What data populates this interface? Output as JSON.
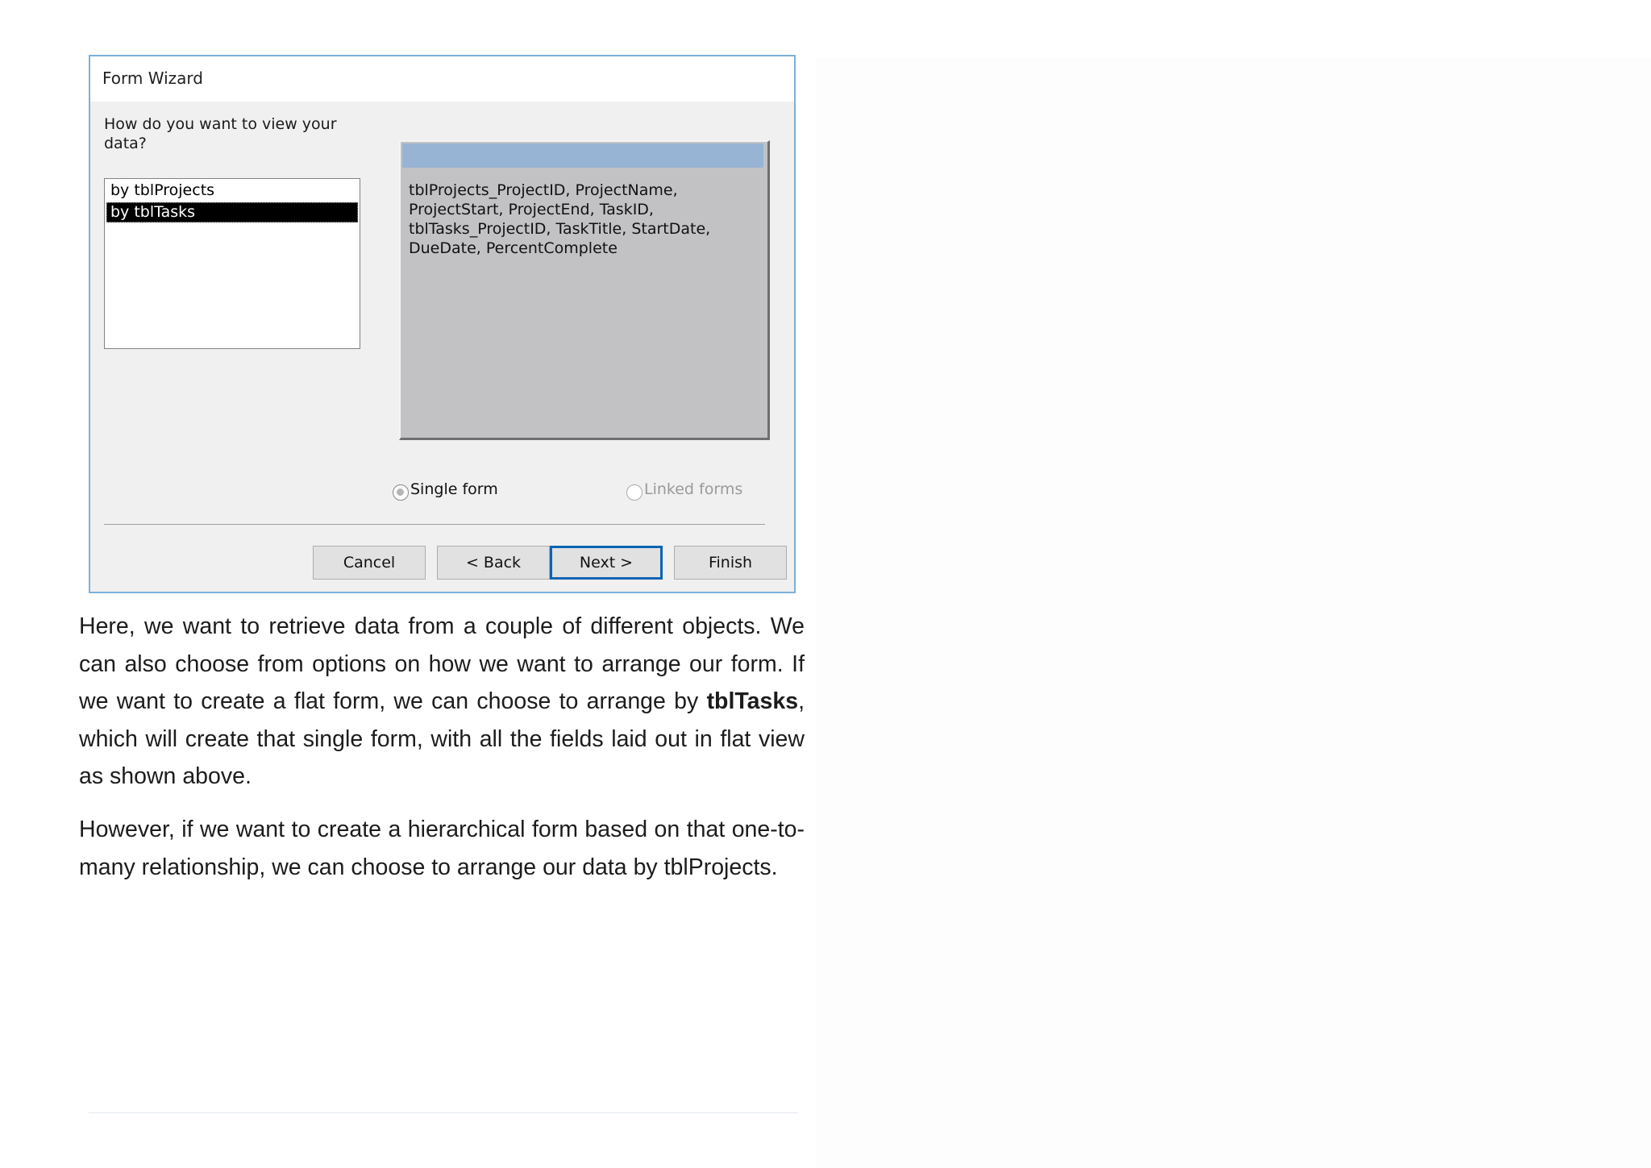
{
  "dialog": {
    "title": "Form Wizard",
    "question": "How do you want to view your data?",
    "view_options": [
      {
        "label": "by tblProjects",
        "selected": false
      },
      {
        "label": "by tblTasks",
        "selected": true
      }
    ],
    "preview_fields": "tblProjects_ProjectID, ProjectName, ProjectStart, ProjectEnd, TaskID, tblTasks_ProjectID, TaskTitle, StartDate, DueDate, PercentComplete",
    "radio_options": [
      {
        "label": "Single form",
        "checked": true,
        "enabled": true
      },
      {
        "label": "Linked forms",
        "checked": false,
        "enabled": false
      }
    ],
    "buttons": {
      "cancel": "Cancel",
      "back": "< Back",
      "next": "Next >",
      "finish": "Finish"
    }
  },
  "content": {
    "paragraph1_before": "Here, we want to retrieve data from a couple of different objects. We can also choose from options on how we want to arrange our form. If we want to create a flat form, we can choose to arrange by ",
    "paragraph1_bold": "tblTasks",
    "paragraph1_after": ", which will create that single form, with all the fields laid out in flat view as shown above.",
    "paragraph2": "However, if we want to create a hierarchical form based on that one-to-many relationship, we can choose to arrange our data by tblProjects."
  }
}
